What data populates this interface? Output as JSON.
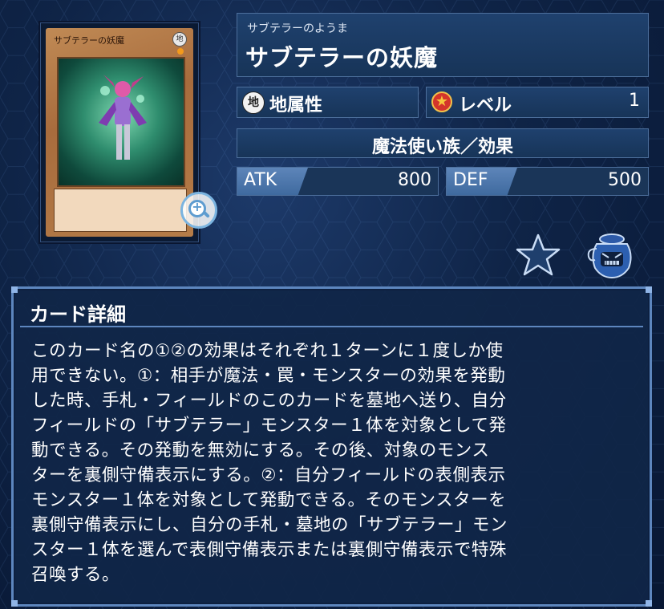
{
  "card": {
    "name_on_card": "サブテラーの妖魔",
    "attribute_glyph": "地",
    "zoom_icon": "zoom-in-icon"
  },
  "header": {
    "ruby": "サブテラーのようま",
    "name": "サブテラーの妖魔"
  },
  "attribute": {
    "icon_text": "地",
    "label": "地属性"
  },
  "level": {
    "label": "レベル",
    "value": "1"
  },
  "type_line": "魔法使い族／効果",
  "stats": {
    "atk_label": "ATK",
    "atk_value": "800",
    "def_label": "DEF",
    "def_value": "500"
  },
  "actions": {
    "favorite_icon": "star-icon",
    "pot_icon": "pot-icon"
  },
  "detail": {
    "title": "カード詳細",
    "lines": [
      "このカード名の①②の効果はそれぞれ１ターンに１度しか使",
      "用できない。①：相手が魔法・罠・モンスターの効果を発動",
      "した時、手札・フィールドのこのカードを墓地へ送り、自分",
      "フィールドの「サブテラー」モンスター１体を対象として発",
      "動できる。その発動を無効にする。その後、対象のモンス",
      "ターを裏側守備表示にする。②：自分フィールドの表側表示",
      "モンスター１体を対象として発動できる。そのモンスターを",
      "裏側守備表示にし、自分の手札・墓地の「サブテラー」モン",
      "スター１体を選んで表側守備表示または裏側守備表示で特殊",
      "召喚する。"
    ]
  },
  "colors": {
    "panel": "#1f416e",
    "border": "#5d86be",
    "level_red": "#d4352b",
    "star_gold": "#f7c63d"
  }
}
